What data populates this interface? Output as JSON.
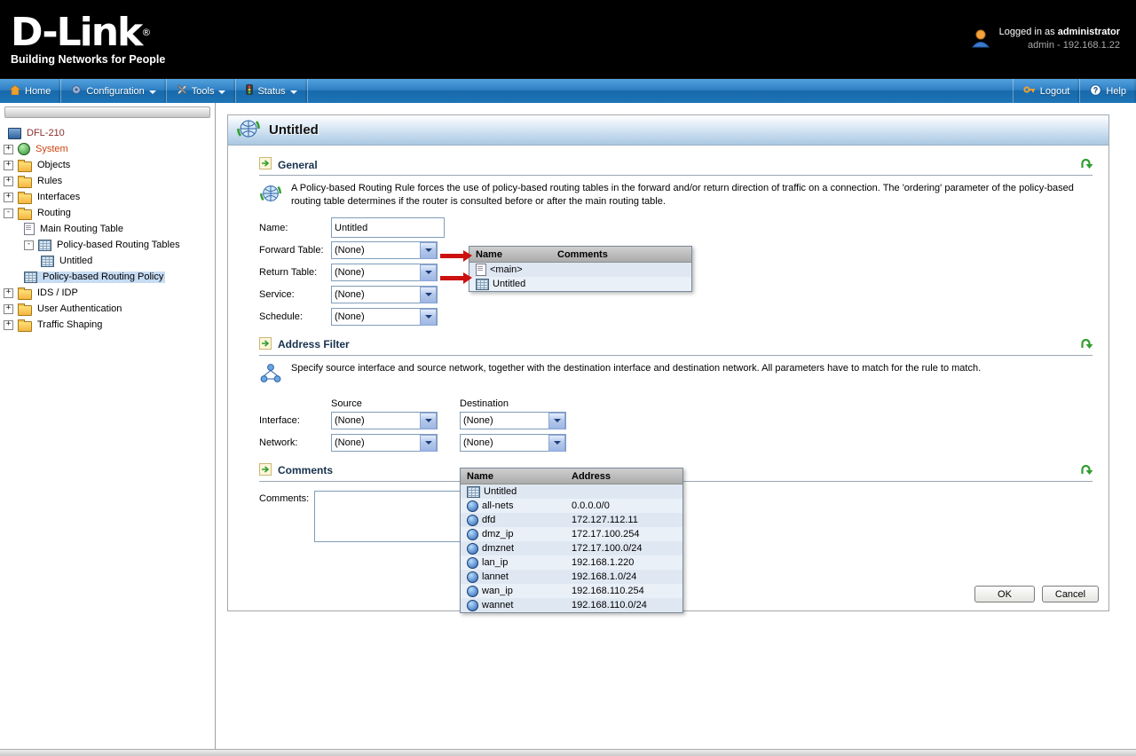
{
  "colors": {
    "header_bg": "#000000",
    "nav_blue": "#2f80c4",
    "selection_blue": "#c6dcf3",
    "annotation_red": "#cc1111",
    "section_green": "#2f9e2f"
  },
  "header": {
    "logo": "D-Link",
    "registered": "®",
    "tagline": "Building Networks for People",
    "login_prefix": "Logged in as",
    "login_user": "administrator",
    "login_detail": "admin - 192.168.1.22"
  },
  "nav": {
    "home": "Home",
    "configuration": "Configuration",
    "tools": "Tools",
    "status": "Status",
    "logout": "Logout",
    "help": "Help"
  },
  "tree": {
    "items": [
      {
        "label": "DFL-210",
        "expand": ""
      },
      {
        "label": "System",
        "expand": "+"
      },
      {
        "label": "Objects",
        "expand": "+"
      },
      {
        "label": "Rules",
        "expand": "+"
      },
      {
        "label": "Interfaces",
        "expand": "+"
      },
      {
        "label": "Routing",
        "expand": "-"
      },
      {
        "label": "Main Routing Table",
        "expand": ""
      },
      {
        "label": "Policy-based Routing Tables",
        "expand": "-"
      },
      {
        "label": "Untitled",
        "expand": ""
      },
      {
        "label": "Policy-based Routing Policy",
        "expand": ""
      },
      {
        "label": "IDS / IDP",
        "expand": "+"
      },
      {
        "label": "User Authentication",
        "expand": "+"
      },
      {
        "label": "Traffic Shaping",
        "expand": "+"
      }
    ]
  },
  "page": {
    "title": "Untitled"
  },
  "general": {
    "title": "General",
    "description": "A Policy-based Routing Rule forces the use of policy-based routing tables in the forward and/or return direction of traffic on a connection. The 'ordering' parameter of the policy-based routing table determines if the router is consulted before or after the main routing table.",
    "name_label": "Name:",
    "name_value": "Untitled",
    "forward_label": "Forward Table:",
    "forward_value": "(None)",
    "return_label": "Return Table:",
    "return_value": "(None)",
    "service_label": "Service:",
    "service_value": "(None)",
    "schedule_label": "Schedule:",
    "schedule_value": "(None)"
  },
  "table_popup": {
    "col_name": "Name",
    "col_comments": "Comments",
    "rows": [
      {
        "name": "<main>",
        "comments": ""
      },
      {
        "name": "Untitled",
        "comments": ""
      }
    ]
  },
  "address": {
    "title": "Address Filter",
    "description": "Specify source interface and source network, together with the destination interface and destination network. All parameters have to match for the rule to match.",
    "source_label": "Source",
    "destination_label": "Destination",
    "interface_label": "Interface:",
    "network_label": "Network:",
    "interface_source": "(None)",
    "interface_dest": "(None)",
    "network_source": "(None)",
    "network_dest": "(None)"
  },
  "network_popup": {
    "col_name": "Name",
    "col_address": "Address",
    "rows": [
      {
        "name": "Untitled",
        "address": ""
      },
      {
        "name": "all-nets",
        "address": "0.0.0.0/0"
      },
      {
        "name": "dfd",
        "address": "172.127.112.11"
      },
      {
        "name": "dmz_ip",
        "address": "172.17.100.254"
      },
      {
        "name": "dmznet",
        "address": "172.17.100.0/24"
      },
      {
        "name": "lan_ip",
        "address": "192.168.1.220"
      },
      {
        "name": "lannet",
        "address": "192.168.1.0/24"
      },
      {
        "name": "wan_ip",
        "address": "192.168.110.254"
      },
      {
        "name": "wannet",
        "address": "192.168.110.0/24"
      }
    ]
  },
  "comments": {
    "title": "Comments",
    "label": "Comments:",
    "value": ""
  },
  "buttons": {
    "ok": "OK",
    "cancel": "Cancel"
  }
}
